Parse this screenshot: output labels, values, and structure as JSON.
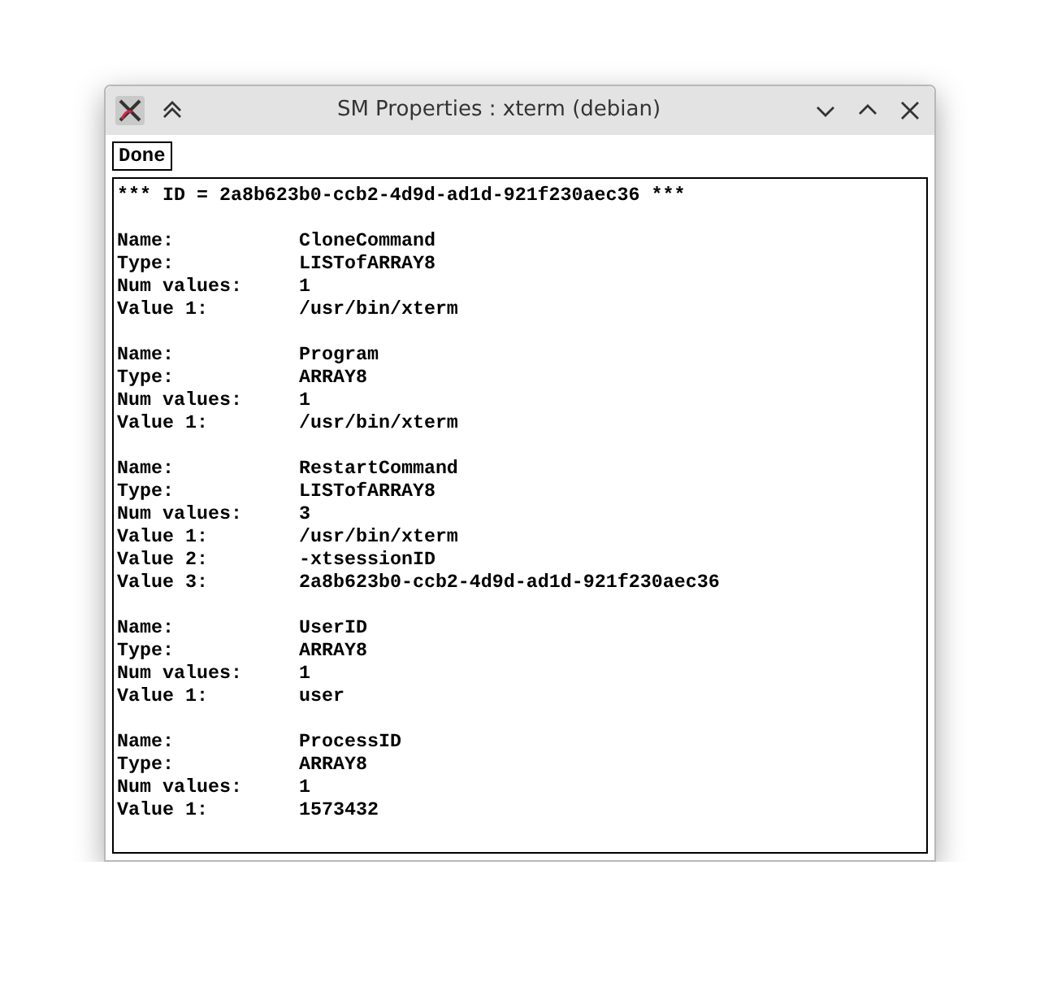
{
  "window": {
    "title": "SM Properties : xterm (debian)"
  },
  "toolbar": {
    "done_button": "Done"
  },
  "header": "*** ID = 2a8b623b0-ccb2-4d9d-ad1d-921f230aec36 ***",
  "properties": [
    {
      "fields": [
        {
          "label": "Name:",
          "value": "CloneCommand"
        },
        {
          "label": "Type:",
          "value": "LISTofARRAY8"
        },
        {
          "label": "Num values:",
          "value": "1"
        },
        {
          "label": "Value 1:",
          "value": "/usr/bin/xterm"
        }
      ]
    },
    {
      "fields": [
        {
          "label": "Name:",
          "value": "Program"
        },
        {
          "label": "Type:",
          "value": "ARRAY8"
        },
        {
          "label": "Num values:",
          "value": "1"
        },
        {
          "label": "Value 1:",
          "value": "/usr/bin/xterm"
        }
      ]
    },
    {
      "fields": [
        {
          "label": "Name:",
          "value": "RestartCommand"
        },
        {
          "label": "Type:",
          "value": "LISTofARRAY8"
        },
        {
          "label": "Num values:",
          "value": "3"
        },
        {
          "label": "Value 1:",
          "value": "/usr/bin/xterm"
        },
        {
          "label": "Value 2:",
          "value": "-xtsessionID"
        },
        {
          "label": "Value 3:",
          "value": "2a8b623b0-ccb2-4d9d-ad1d-921f230aec36"
        }
      ]
    },
    {
      "fields": [
        {
          "label": "Name:",
          "value": "UserID"
        },
        {
          "label": "Type:",
          "value": "ARRAY8"
        },
        {
          "label": "Num values:",
          "value": "1"
        },
        {
          "label": "Value 1:",
          "value": "user"
        }
      ]
    },
    {
      "fields": [
        {
          "label": "Name:",
          "value": "ProcessID"
        },
        {
          "label": "Type:",
          "value": "ARRAY8"
        },
        {
          "label": "Num values:",
          "value": "1"
        },
        {
          "label": "Value 1:",
          "value": "1573432"
        }
      ]
    }
  ]
}
